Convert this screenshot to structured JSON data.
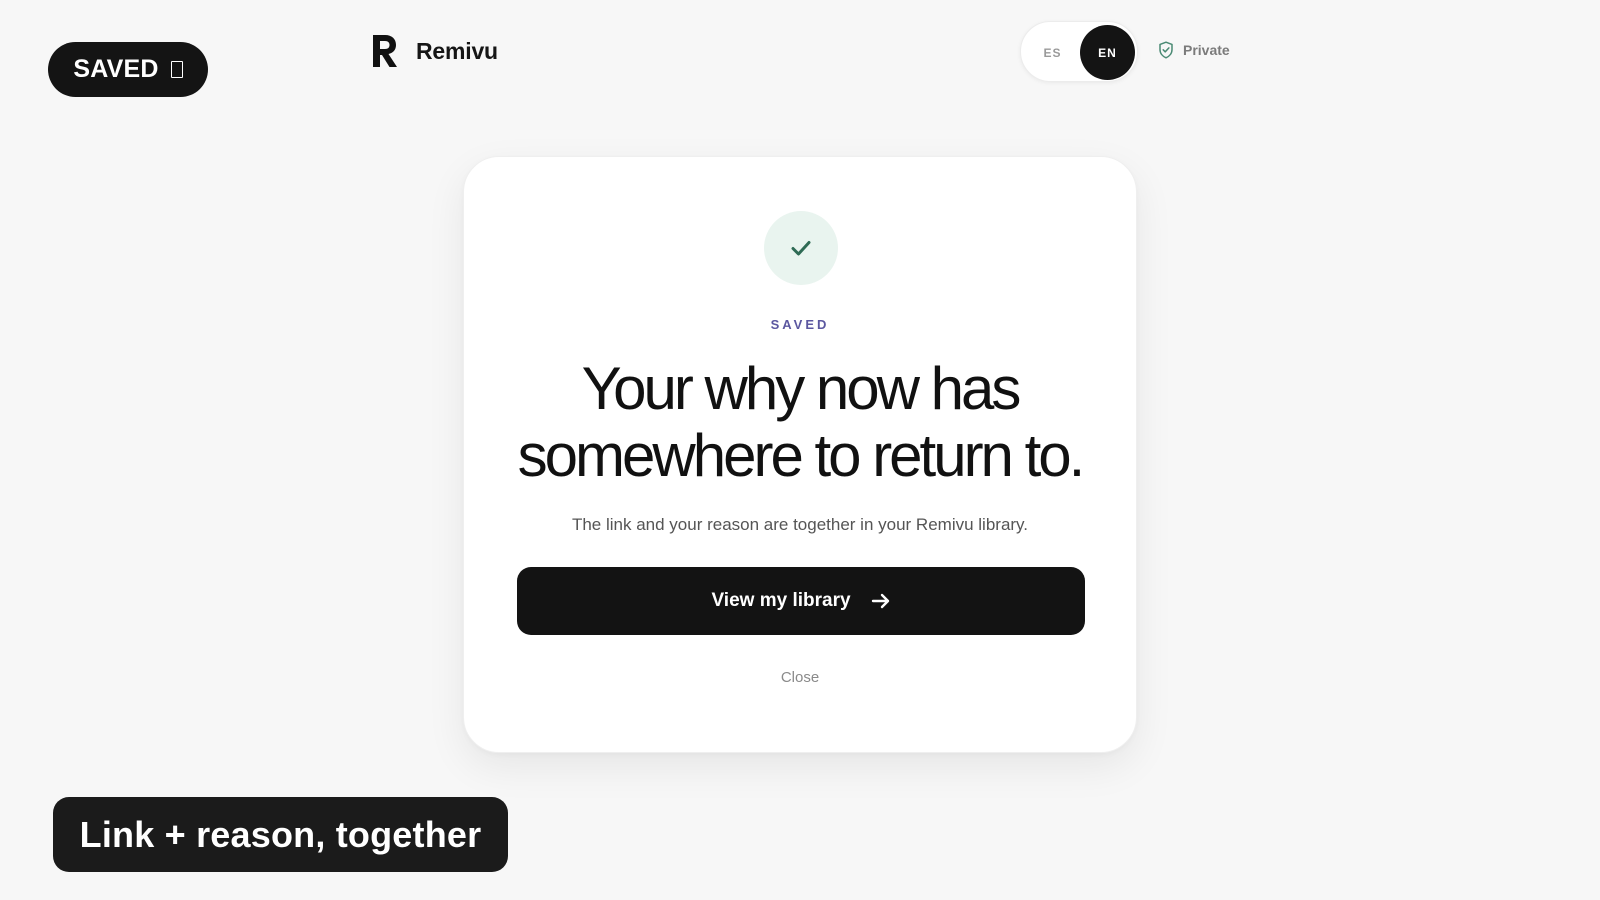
{
  "overlay": {
    "saved_pill_label": "SAVED",
    "caption": "Link + reason, together"
  },
  "header": {
    "brand_name": "Remivu",
    "language": {
      "options": [
        "ES",
        "EN"
      ],
      "selected": "EN"
    },
    "privacy_label": "Private"
  },
  "modal": {
    "eyebrow": "SAVED",
    "headline_line1": "Your why now has",
    "headline_line2": "somewhere to return to.",
    "subtext": "The link and your reason are together in your Remivu library.",
    "cta_label": "View my library",
    "close_label": "Close"
  },
  "icons": {
    "brand_logo": "brand-logo-r",
    "check": "check-icon",
    "shield": "shield-check-icon",
    "arrow": "arrow-right-icon"
  },
  "colors": {
    "background": "#f7f7f7",
    "primary_dark": "#131313",
    "eyebrow_accent": "#5b57a0",
    "success_tint": "#e9f4ef",
    "success_check": "#2f6b55"
  }
}
